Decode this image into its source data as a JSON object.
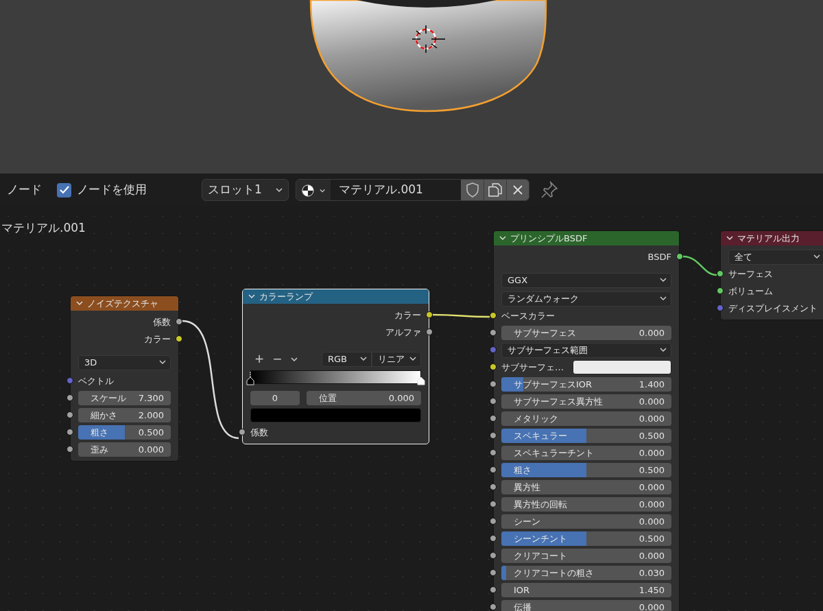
{
  "header": {
    "editor_label": "ノード",
    "use_nodes": {
      "label": "ノードを使用",
      "checked": true
    },
    "slot": "スロット1",
    "material": "マテリアル.001"
  },
  "breadcrumb": "マテリアル.001",
  "nodes": [
    {
      "title": "ノイズテクスチャ",
      "color": "#8c4e1f",
      "selected": false,
      "rows": [
        {
          "kind": "output",
          "label": "係数",
          "color": "#a1a1a1"
        },
        {
          "kind": "output",
          "label": "カラー",
          "color": "#c7c729"
        },
        {
          "kind": "dropdown",
          "value": "3D"
        },
        {
          "kind": "input",
          "label": "ベクトル",
          "color": "#6363c7"
        },
        {
          "kind": "number",
          "label": "スケール",
          "value": "7.300",
          "color": "#a1a1a1"
        },
        {
          "kind": "number",
          "label": "細かさ",
          "value": "2.000",
          "color": "#a1a1a1"
        },
        {
          "kind": "slider",
          "label": "粗さ",
          "value": "0.500",
          "level": 0.5,
          "color": "#a1a1a1"
        },
        {
          "kind": "number",
          "label": "歪み",
          "value": "0.000",
          "color": "#a1a1a1"
        }
      ]
    },
    {
      "title": "カラーランプ",
      "color": "#246283",
      "selected": true,
      "rows": [
        {
          "kind": "output",
          "label": "カラー",
          "color": "#c7c729"
        },
        {
          "kind": "output",
          "label": "アルファ",
          "color": "#a1a1a1"
        },
        {
          "kind": "ramp_controls",
          "add": "+",
          "remove": "−",
          "color_mode": "RGB",
          "interpolation": "リニア"
        },
        {
          "kind": "ramp",
          "stops": [
            {
              "selected": true,
              "color": "#000000"
            },
            {
              "selected": false,
              "color": "#ffffff"
            }
          ]
        },
        {
          "kind": "stop_fields",
          "index": "0",
          "label": "位置",
          "value": "0.000"
        },
        {
          "kind": "swatch",
          "color": "#000000"
        },
        {
          "kind": "input",
          "label": "係数",
          "color": "#a1a1a1"
        }
      ]
    },
    {
      "title": "プリンシプルBSDF",
      "color": "#2b652b",
      "selected": false,
      "rows": [
        {
          "kind": "output",
          "label": "BSDF",
          "color": "#63c763"
        },
        {
          "kind": "dropdown",
          "value": "GGX"
        },
        {
          "kind": "dropdown",
          "value": "ランダムウォーク"
        },
        {
          "kind": "input",
          "label": "ベースカラー",
          "color": "#c7c729"
        },
        {
          "kind": "slider",
          "label": "サブサーフェス",
          "value": "0.000",
          "level": 0,
          "color": "#a1a1a1"
        },
        {
          "kind": "socket_dropdown",
          "value": "サブサーフェス範囲",
          "color": "#6363c7"
        },
        {
          "kind": "color_input",
          "label": "サブサーフェ…",
          "swatch": {
            "color": "#ececec"
          },
          "color": "#c7c729"
        },
        {
          "kind": "slider",
          "label": "サブサーフェスIOR",
          "value": "1.400",
          "level": 0.13,
          "color": "#a1a1a1"
        },
        {
          "kind": "slider",
          "label": "サブサーフェス異方性",
          "value": "0.000",
          "level": 0,
          "color": "#a1a1a1"
        },
        {
          "kind": "slider",
          "label": "メタリック",
          "value": "0.000",
          "level": 0,
          "color": "#a1a1a1"
        },
        {
          "kind": "slider",
          "label": "スペキュラー",
          "value": "0.500",
          "level": 0.5,
          "color": "#a1a1a1"
        },
        {
          "kind": "slider",
          "label": "スペキュラーチント",
          "value": "0.000",
          "level": 0,
          "color": "#a1a1a1"
        },
        {
          "kind": "slider",
          "label": "粗さ",
          "value": "0.500",
          "level": 0.5,
          "color": "#a1a1a1"
        },
        {
          "kind": "slider",
          "label": "異方性",
          "value": "0.000",
          "level": 0,
          "color": "#a1a1a1"
        },
        {
          "kind": "slider",
          "label": "異方性の回転",
          "value": "0.000",
          "level": 0,
          "color": "#a1a1a1"
        },
        {
          "kind": "slider",
          "label": "シーン",
          "value": "0.000",
          "level": 0,
          "color": "#a1a1a1"
        },
        {
          "kind": "slider",
          "label": "シーンチント",
          "value": "0.500",
          "level": 0.5,
          "color": "#a1a1a1"
        },
        {
          "kind": "slider",
          "label": "クリアコート",
          "value": "0.000",
          "level": 0,
          "color": "#a1a1a1"
        },
        {
          "kind": "slider",
          "label": "クリアコートの粗さ",
          "value": "0.030",
          "level": 0.03,
          "color": "#a1a1a1"
        },
        {
          "kind": "number",
          "label": "IOR",
          "value": "1.450",
          "color": "#a1a1a1"
        },
        {
          "kind": "slider",
          "label": "伝播",
          "value": "0.000",
          "level": 0,
          "color": "#a1a1a1"
        }
      ]
    },
    {
      "title": "マテリアル出力",
      "color": "#5a1f2c",
      "selected": false,
      "rows": [
        {
          "kind": "dropdown",
          "value": "全て"
        },
        {
          "kind": "input",
          "label": "サーフェス",
          "color": "#63c763"
        },
        {
          "kind": "input",
          "label": "ボリューム",
          "color": "#63c763"
        },
        {
          "kind": "input",
          "label": "ディスプレイスメント",
          "color": "#6363c7"
        }
      ]
    }
  ]
}
